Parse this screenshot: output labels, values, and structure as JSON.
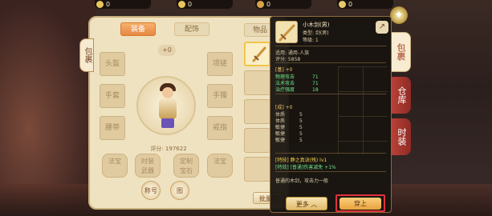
{
  "currency": [
    {
      "value": "0",
      "color": "#e9c65b"
    },
    {
      "value": "0",
      "color": "#e9c65b"
    },
    {
      "value": "0",
      "color": "#d9a34a"
    },
    {
      "value": "0",
      "color": "#e6c96c"
    }
  ],
  "left_tab": {
    "label": "包裹"
  },
  "tabs": {
    "equip": "装备",
    "accessory": "配饰",
    "items": "物品"
  },
  "plus": "+0",
  "slots": {
    "helmet": "头盔",
    "gloves": "手套",
    "belt": "腰带",
    "necklace": "项链",
    "bracelet": "手镯",
    "ring": "戒指",
    "left_hand": "法宝",
    "right_hand": "法宝",
    "fashion1": "时装\n武器",
    "fashion2": "定制\n宝石"
  },
  "score": "评分: 197622",
  "round_buttons": {
    "left": "称号",
    "right": "图"
  },
  "batch_btn": "批量回",
  "tooltip": {
    "name": "小木剑(男)",
    "type": "类型: 剑(男)",
    "level": "等级: 1",
    "usage": "适用: 通用-人族",
    "score": "评分: 5858",
    "base_title": "[基] +0",
    "attrs": [
      {
        "label": "物理攻击",
        "value": "71"
      },
      {
        "label": "法术攻击",
        "value": "71"
      },
      {
        "label": "治疗强度",
        "value": "18"
      }
    ],
    "growth_title": "[成] +0",
    "growth": [
      {
        "label": "体质",
        "value": "5"
      },
      {
        "label": "体质",
        "value": "5"
      },
      {
        "label": "敏捷",
        "value": "5"
      },
      {
        "label": "敏捷",
        "value": "5"
      },
      {
        "label": "敏捷",
        "value": "5"
      }
    ],
    "special1": "[特技] 静之真诀(残) lv1",
    "special2": "[特效] [普通]伤害减免 +1%",
    "desc": "普通的木剑，攻击力一般",
    "more": "更多 ︿",
    "equip": "穿上"
  },
  "right_tabs": {
    "bag": "包裹",
    "warehouse": "仓库",
    "fashion": "时装"
  }
}
